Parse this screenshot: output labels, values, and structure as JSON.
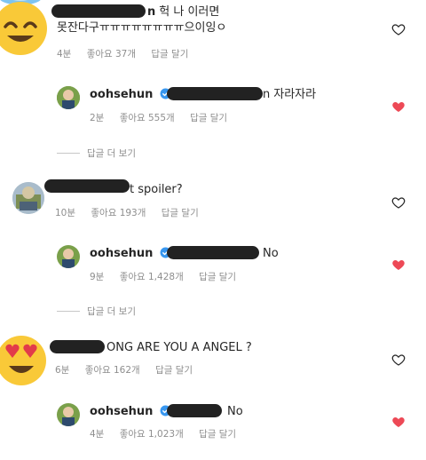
{
  "comments": [
    {
      "text": "헉 나 이러면",
      "text2": "못잔다구ㅠㅠㅠㅠㅠㅠㅠㅠ으이잉ㅇ",
      "time": "4분",
      "likes": "좋아요 37개",
      "reply": "답글 달기",
      "liked": false
    },
    {
      "username": "oohsehun",
      "mention_prefix": "@",
      "text": "자라자라",
      "time": "2분",
      "likes": "좋아요 555개",
      "reply": "답글 달기",
      "liked": true
    },
    {
      "text": "t spoiler?",
      "time": "10분",
      "likes": "좋아요 193개",
      "reply": "답글 달기",
      "liked": false
    },
    {
      "username": "oohsehun",
      "mention_prefix": "@",
      "text": "No",
      "time": "9분",
      "likes": "좋아요 1,428개",
      "reply": "답글 달기",
      "liked": true
    },
    {
      "text": "ONG ARE YOU A ANGEL ?",
      "time": "6분",
      "likes": "좋아요 162개",
      "reply": "답글 달기",
      "liked": false
    },
    {
      "username": "oohsehun",
      "mention_prefix": "@",
      "text": "No",
      "time": "4분",
      "likes": "좋아요 1,023개",
      "reply": "답글 달기",
      "liked": true
    }
  ],
  "view_more": "답글 더 보기",
  "colors": {
    "heart_red": "#ed4956",
    "verified_blue": "#3897f0",
    "meta_gray": "#8e8e8e"
  },
  "icons": {
    "emoji_halo": "smiling-face-with-halo-icon",
    "emoji_heart_eyes": "smiling-face-with-heart-eyes-icon",
    "heart_outline": "heart-outline-icon",
    "heart_filled": "heart-filled-icon",
    "verified": "verified-badge-icon"
  }
}
